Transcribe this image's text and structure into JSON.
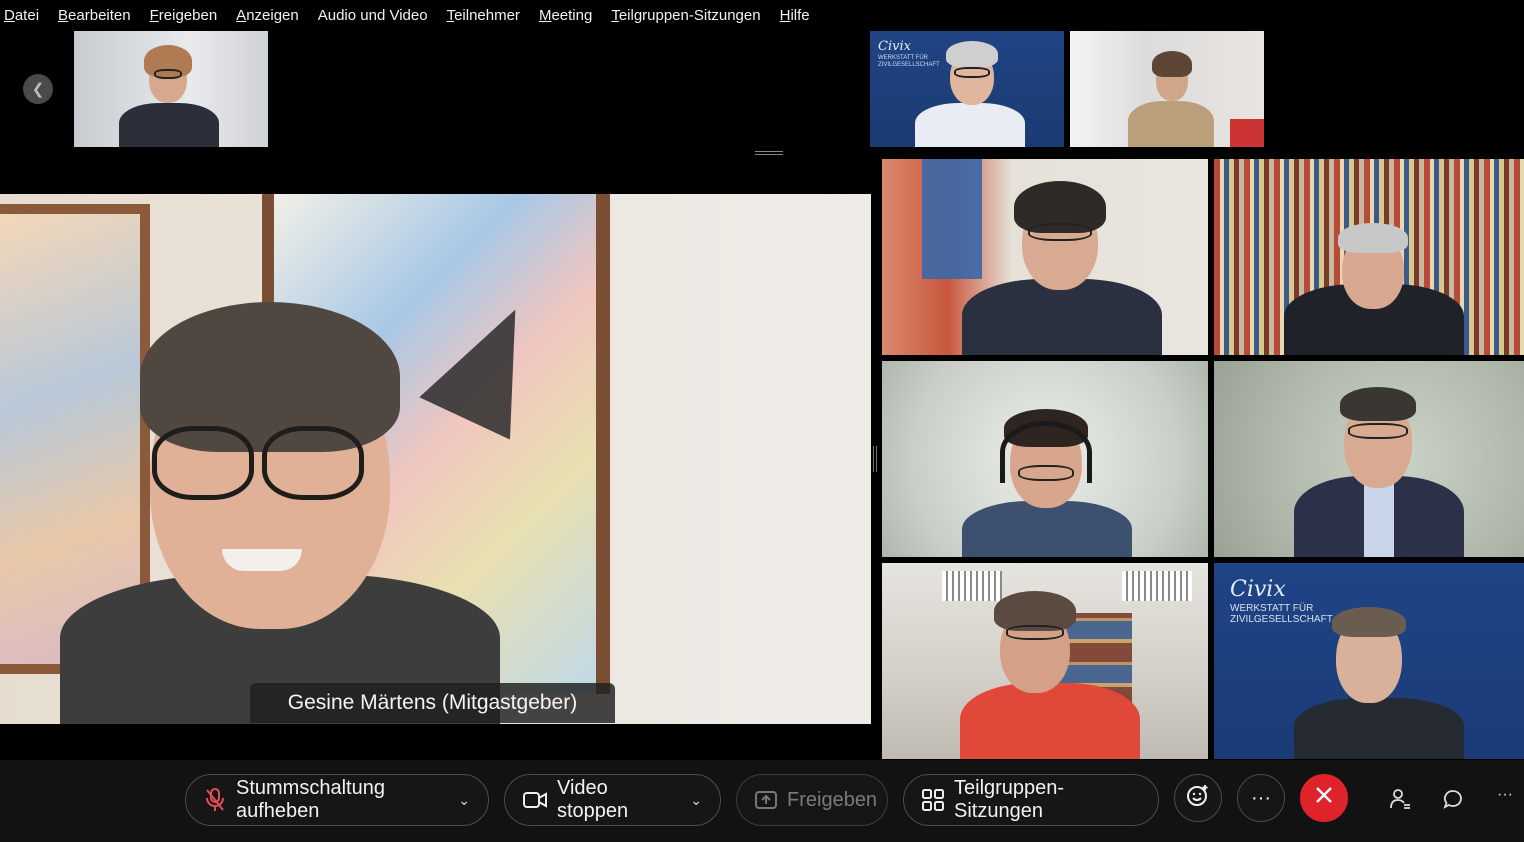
{
  "menu": [
    {
      "label": "Datei",
      "accel": "D",
      "rest": "atei"
    },
    {
      "label": "Bearbeiten",
      "accel": "B",
      "rest": "earbeiten"
    },
    {
      "label": "Freigeben",
      "accel": "F",
      "rest": "reigeben"
    },
    {
      "label": "Anzeigen",
      "accel": "A",
      "rest": "nzeigen"
    },
    {
      "label": "Audio und Video",
      "accel": "",
      "rest": "Audio und Video"
    },
    {
      "label": "Teilnehmer",
      "accel": "T",
      "rest": "eilnehmer"
    },
    {
      "label": "Meeting",
      "accel": "M",
      "rest": "eeting"
    },
    {
      "label": "Teilgruppen-Sitzungen",
      "accel": "T",
      "rest": "eilgruppen-Sitzungen"
    },
    {
      "label": "Hilfe",
      "accel": "H",
      "rest": "ilfe"
    }
  ],
  "main_speaker": {
    "name_label": "Gesine Märtens (Mitgastgeber)"
  },
  "logo": {
    "brand": "Civix",
    "line1": "WERKSTATT FÜR",
    "line2": "ZIVILGESELLSCHAFT"
  },
  "toolbar": {
    "unmute_label": "Stummschaltung aufheben",
    "video_label": "Video stoppen",
    "share_label": "Freigeben",
    "breakout_label": "Teilgruppen-Sitzungen",
    "more_label": "···"
  },
  "colors": {
    "end_call": "#e0222b",
    "background": "#000000",
    "toolbar": "#121212"
  }
}
